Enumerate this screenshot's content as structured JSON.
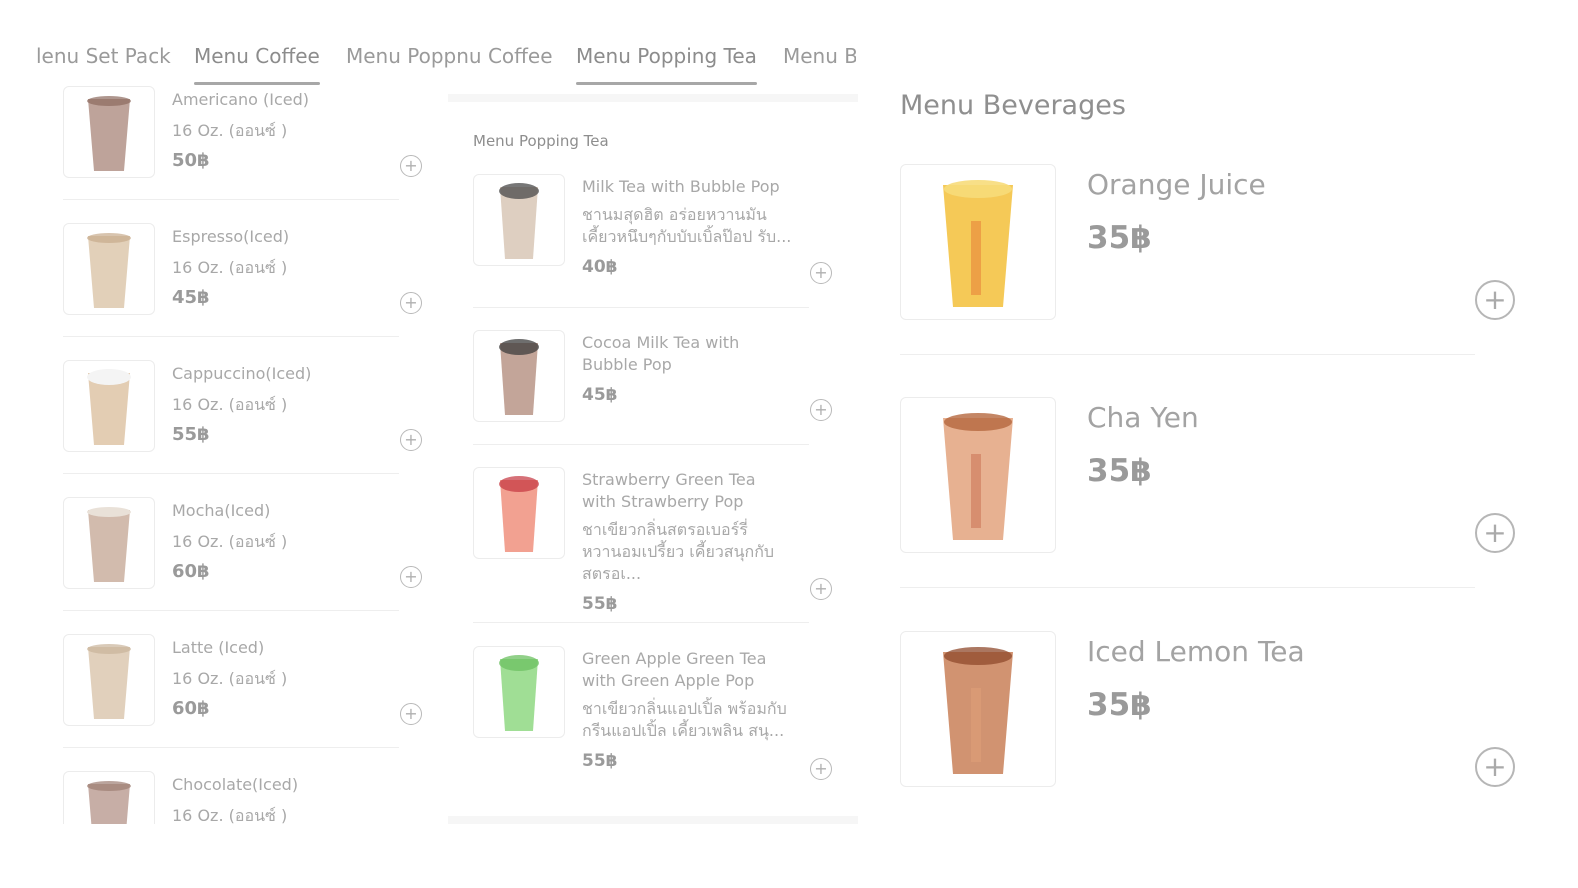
{
  "tabs": [
    {
      "label": "lenu Set Pack",
      "active": false
    },
    {
      "label": "Menu Coffee",
      "active": true
    },
    {
      "label": "Menu Poppnu Coffee",
      "active": false
    },
    {
      "label": "Menu Popping Tea",
      "active": true
    },
    {
      "label": "Menu B",
      "active": false
    }
  ],
  "coffee": {
    "items": [
      {
        "name": "Americano (Iced)",
        "size": "16 Oz. (ออนซ์ )",
        "price": "50฿",
        "icon": "iced-americano-cup"
      },
      {
        "name": "Espresso(Iced)",
        "size": "16 Oz. (ออนซ์ )",
        "price": "45฿",
        "icon": "iced-espresso-cup"
      },
      {
        "name": "Cappuccino(Iced)",
        "size": "16 Oz. (ออนซ์ )",
        "price": "55฿",
        "icon": "iced-cappuccino-cup"
      },
      {
        "name": "Mocha(Iced)",
        "size": "16 Oz. (ออนซ์ )",
        "price": "60฿",
        "icon": "iced-mocha-cup"
      },
      {
        "name": "Latte (Iced)",
        "size": "16 Oz. (ออนซ์ )",
        "price": "60฿",
        "icon": "iced-latte-cup"
      },
      {
        "name": "Chocolate(Iced)",
        "size": "16 Oz. (ออนซ์ )",
        "price": "",
        "icon": "iced-chocolate-cup"
      }
    ],
    "add_symbol": "+"
  },
  "popping": {
    "title": "Menu Popping Tea",
    "items": [
      {
        "name": "Milk Tea with Bubble Pop",
        "desc": "ชานมสุดฮิต อร่อยหวานมัน เคี้ยวหนึบๆกับบับเบิ้ลป๊อป รับ...",
        "price": "40฿",
        "icon": "milk-tea-bubble-cup"
      },
      {
        "name": "Cocoa Milk Tea with Bubble Pop",
        "desc": "",
        "price": "45฿",
        "icon": "cocoa-milk-tea-cup"
      },
      {
        "name": "Strawberry Green Tea with Strawberry  Pop",
        "desc": "ชาเขียวกลิ่นสตรอเบอร์รี่ หวานอมเปรี้ยว เคี้ยวสนุกกับสตรอเ...",
        "price": "55฿",
        "icon": "strawberry-tea-cup"
      },
      {
        "name": "Green Apple Green Tea with Green Apple Pop",
        "desc": "ชาเขียวกลิ่นแอปเปิ้ล พร้อมกับกรีนแอปเปิ้ล เคี้ยวเพลิน สนุ...",
        "price": "55฿",
        "icon": "green-apple-tea-cup"
      }
    ],
    "add_symbol": "+"
  },
  "beverages": {
    "title": "Menu Beverages",
    "items": [
      {
        "name": "Orange Juice",
        "price": "35฿",
        "icon": "orange-juice-cup"
      },
      {
        "name": "Cha Yen",
        "price": "35฿",
        "icon": "cha-yen-cup"
      },
      {
        "name": "Iced Lemon Tea",
        "price": "35฿",
        "icon": "iced-lemon-tea-cup"
      }
    ],
    "add_symbol": "+"
  },
  "colors": {
    "orange_juice": "#f3c03a",
    "cha_yen": "#e3a37e",
    "lemon_tea": "#c98058",
    "strawberry": "#ef8a76",
    "green_apple": "#8fd882",
    "coffee_light": "#dbc4a8",
    "coffee_dark": "#a88478"
  }
}
